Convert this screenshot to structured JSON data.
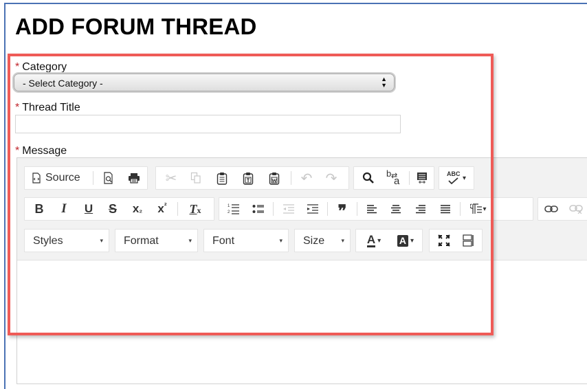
{
  "page": {
    "title": "ADD FORUM THREAD"
  },
  "form": {
    "required_marker": "*",
    "category": {
      "label": "Category",
      "selected": "- Select Category -"
    },
    "thread_title": {
      "label": "Thread Title",
      "value": "",
      "placeholder": ""
    },
    "message": {
      "label": "Message"
    }
  },
  "editor": {
    "source_label": "Source",
    "combos": {
      "styles": "Styles",
      "format": "Format",
      "font": "Font",
      "size": "Size"
    },
    "combo_chevron": "▾",
    "glyphs": {
      "bold": "B",
      "italic": "I",
      "underline": "U",
      "strike": "S",
      "subscript": "x",
      "subscript_mark": "₂",
      "superscript": "x",
      "superscript_mark": "²",
      "remove_format": "T",
      "remove_format_mark": "x",
      "blockquote": "❞",
      "undo": "↶",
      "redo": "↷",
      "cut": "✂",
      "spellcheck": "ABC",
      "text_color": "A",
      "bg_color": "A",
      "find_replace_top": "b",
      "find_replace_bottom": "a"
    }
  },
  "colors": {
    "highlight_border": "#ef5b57",
    "required": "#c0262d",
    "frame_border": "#4a72b4"
  }
}
